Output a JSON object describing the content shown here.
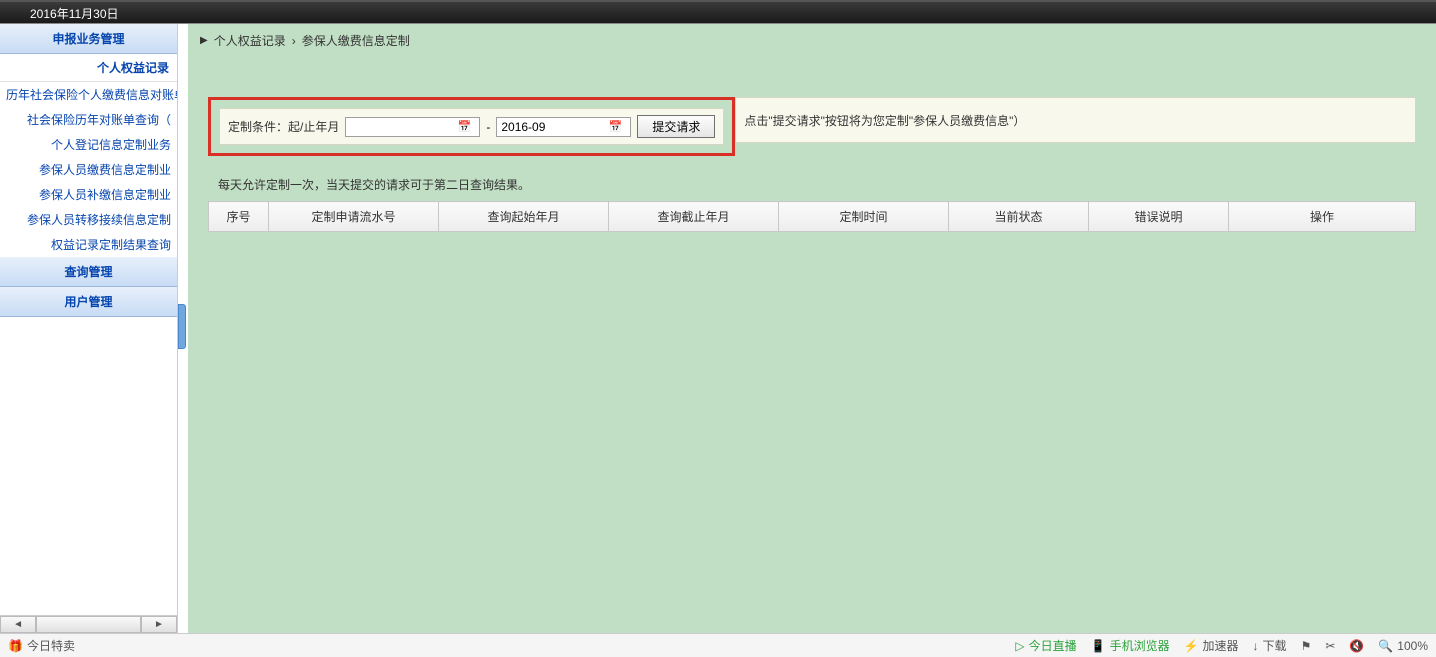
{
  "topbar": {
    "date_text": "2016年11月30日"
  },
  "sidebar": {
    "section1": "申报业务管理",
    "subsection": "个人权益记录",
    "items": [
      "历年社会保险个人缴费信息对账单",
      "社会保险历年对账单查询（",
      "个人登记信息定制业务",
      "参保人员缴费信息定制业",
      "参保人员补缴信息定制业",
      "参保人员转移接续信息定制",
      "权益记录定制结果查询"
    ],
    "section2": "查询管理",
    "section3": "用户管理"
  },
  "breadcrumb": {
    "item1": "个人权益记录",
    "sep": "›",
    "item2": "参保人缴费信息定制"
  },
  "form": {
    "label_prefix": "定制条件：起/止年月",
    "start_value": "",
    "dash": "-",
    "end_value": "2016-09",
    "submit_label": "提交请求",
    "hint": "点击\"提交请求\"按钮将为您定制\"参保人员缴费信息\"）"
  },
  "note": "每天允许定制一次，当天提交的请求可于第二日查询结果。",
  "table": {
    "headers": [
      "序号",
      "定制申请流水号",
      "查询起始年月",
      "查询截止年月",
      "定制时间",
      "当前状态",
      "错误说明",
      "操作"
    ]
  },
  "bottombar": {
    "left": "今日特卖",
    "items": {
      "live": "今日直播",
      "mobile": "手机浏览器",
      "accel": "加速器",
      "download": "下载",
      "zoom": "100%"
    }
  }
}
